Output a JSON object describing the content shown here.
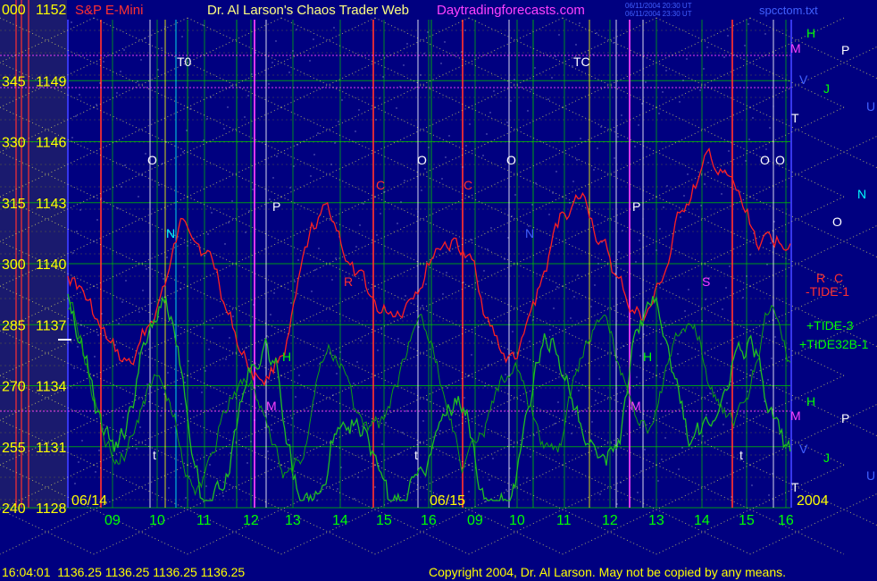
{
  "header": {
    "title_prefix": "Dr. Al Larson's Chaos Trader Web",
    "site": "Daytradingforecasts.com",
    "instrument": "S&P E-Mini",
    "corner_value": "000",
    "corner_price": "1152",
    "file_name": "spcctom.txt",
    "timestamp_1": "06/11/2004 20:30 UT",
    "timestamp_2": "06/11/2004 23:30 UT"
  },
  "status": {
    "time": "16:04:01",
    "quotes": "1136.25 1136.25 1136.25 1136.25",
    "copyright": "Copyright 2004, Dr. Al Larson. May not be copied by any means."
  },
  "chart_data": {
    "type": "line",
    "title": "",
    "price_ticks": [
      {
        "code": "345",
        "price": "1149"
      },
      {
        "code": "330",
        "price": "1146"
      },
      {
        "code": "315",
        "price": "1143"
      },
      {
        "code": "300",
        "price": "1140"
      },
      {
        "code": "285",
        "price": "1137"
      },
      {
        "code": "270",
        "price": "1134"
      },
      {
        "code": "255",
        "price": "1131"
      },
      {
        "code": "240",
        "price": "1128"
      }
    ],
    "ylim": [
      1128,
      1152
    ],
    "x_ticks": [
      "09",
      "10",
      "11",
      "12",
      "13",
      "14",
      "15",
      "16",
      "09",
      "10",
      "11",
      "12",
      "13",
      "14",
      "15",
      "16"
    ],
    "dates": [
      "06/14",
      "06/15"
    ],
    "year": "2004",
    "legend": [
      "-TIDE-1",
      "+TIDE-3",
      "+TIDE32B-1"
    ],
    "colors": {
      "background": "#000080",
      "grid_green": "#00c000",
      "price_label": "#ffff00",
      "red_series": "#ff2020",
      "green_series": "#20c020",
      "magenta": "#ff40ff"
    },
    "markers": {
      "right_letters": [
        "H",
        "M",
        "P",
        "V",
        "J",
        "U",
        "T",
        "N",
        "O",
        "R",
        "C",
        "H",
        "M",
        "P",
        "V",
        "J",
        "U",
        "T"
      ],
      "chart_letters": [
        "T0",
        "TC",
        "O",
        "O",
        "O",
        "O",
        "O",
        "N",
        "N",
        "P",
        "P",
        "C",
        "C",
        "R",
        "S",
        "H",
        "H",
        "M",
        "M",
        "t",
        "t",
        "t"
      ]
    }
  }
}
